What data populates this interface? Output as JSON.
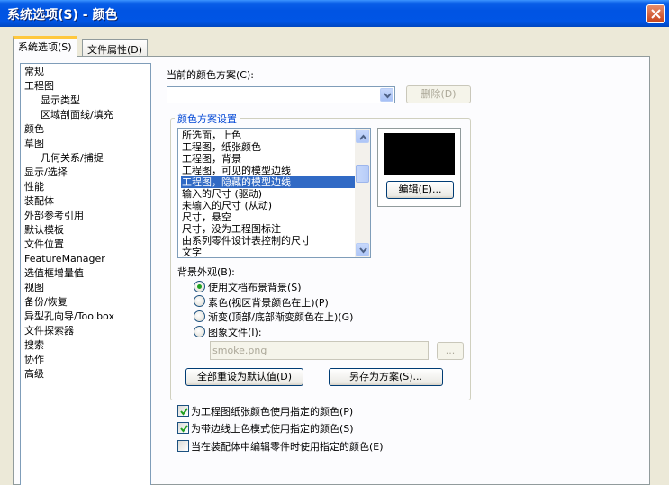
{
  "window": {
    "title": "系统选项(S) - 颜色"
  },
  "tabs": [
    {
      "label": "系统选项(S)",
      "active": true
    },
    {
      "label": "文件属性(D)",
      "active": false
    }
  ],
  "nav": {
    "items": [
      {
        "label": "常规"
      },
      {
        "label": "工程图"
      },
      {
        "label": "显示类型"
      },
      {
        "label": "区域剖面线/填充"
      },
      {
        "label": "颜色",
        "selected": true
      },
      {
        "label": "草图"
      },
      {
        "label": "几何关系/捕捉"
      },
      {
        "label": "显示/选择"
      },
      {
        "label": "性能"
      },
      {
        "label": "装配体"
      },
      {
        "label": "外部参考引用"
      },
      {
        "label": "默认模板"
      },
      {
        "label": "文件位置"
      },
      {
        "label": "FeatureManager"
      },
      {
        "label": "选值框增量值"
      },
      {
        "label": "视图"
      },
      {
        "label": "备份/恢复"
      },
      {
        "label": "异型孔向导/Toolbox"
      },
      {
        "label": "文件探索器"
      },
      {
        "label": "搜索"
      },
      {
        "label": "协作"
      },
      {
        "label": "高级"
      }
    ]
  },
  "scheme": {
    "label": "当前的颜色方案(C):",
    "value": "",
    "delete_label": "删除(D)"
  },
  "settings": {
    "group_title": "颜色方案设置",
    "items": [
      "所选面，上色",
      "工程图，纸张颜色",
      "工程图，背景",
      "工程图，可见的模型边线",
      "工程图，隐藏的模型边线",
      "输入的尺寸 (驱动)",
      "未输入的尺寸 (从动)",
      "尺寸，悬空",
      "尺寸，没为工程图标注",
      "由系列零件设计表控制的尺寸",
      "文字"
    ],
    "selected_index": 4,
    "preview_color": "#000000",
    "edit_label": "编辑(E)..."
  },
  "background": {
    "label": "背景外观(B):",
    "options": [
      {
        "label": "使用文档布景背景(S)",
        "selected": true
      },
      {
        "label": "素色(视区背景颜色在上)(P)",
        "selected": false
      },
      {
        "label": "渐变(顶部/底部渐变颜色在上)(G)",
        "selected": false
      },
      {
        "label": "图象文件(I):",
        "selected": false
      }
    ],
    "image_file": "smoke.png",
    "browse_label": "...",
    "reset_label": "全部重设为默认值(D)",
    "save_as_label": "另存为方案(S)..."
  },
  "checkboxes": [
    {
      "label": "为工程图纸张颜色使用指定的颜色(P)",
      "checked": true
    },
    {
      "label": "为带边线上色模式使用指定的颜色(S)",
      "checked": true
    },
    {
      "label": "当在装配体中编辑零件时使用指定的颜色(E)",
      "checked": false
    }
  ]
}
